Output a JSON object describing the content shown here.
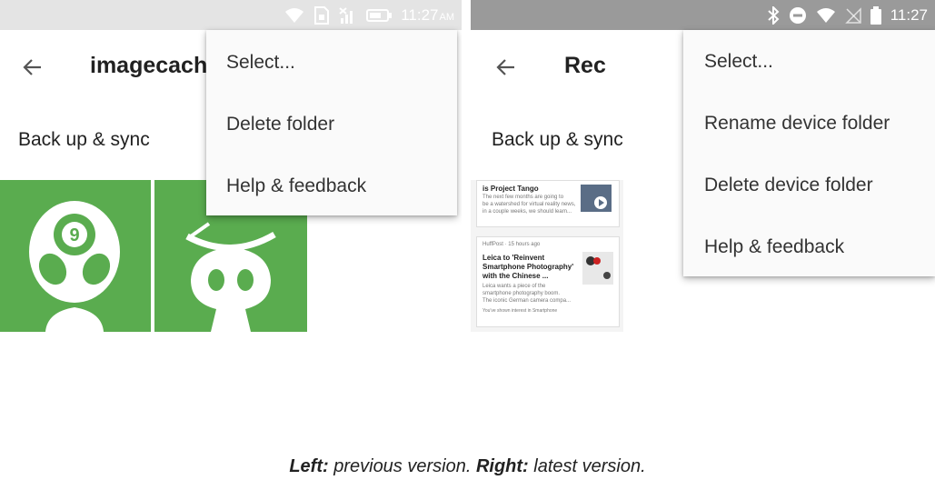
{
  "left_screen": {
    "status": {
      "time": "11:27",
      "ampm": "AM",
      "icons": [
        "wifi-icon",
        "sim-card-icon",
        "no-signal-icon",
        "battery-icon"
      ]
    },
    "toolbar": {
      "title": "imagecache",
      "back_icon": "back-arrow-icon"
    },
    "section_label": "Back up & sync",
    "menu": {
      "items": [
        "Select...",
        "Delete folder",
        "Help & feedback"
      ]
    },
    "tiles": [
      "alien-sticker-image",
      "hat-sticker-image"
    ],
    "colors": {
      "status_bar": "#e4e4e4",
      "tile_green": "#5aac4f",
      "menu_bg": "#fafafa"
    }
  },
  "right_screen": {
    "status": {
      "time": "11:27",
      "icons": [
        "bluetooth-icon",
        "do-not-disturb-icon",
        "wifi-icon",
        "no-sim-icon",
        "battery-icon"
      ]
    },
    "toolbar": {
      "title": "Rec",
      "back_icon": "back-arrow-icon"
    },
    "section_label": "Back up & sync",
    "menu": {
      "items": [
        "Select...",
        "Rename device folder",
        "Delete device folder",
        "Help & feedback"
      ]
    },
    "thumbnail": {
      "card1": {
        "title": "is Project Tango",
        "lines": [
          "The next few months are going to",
          "be a watershed for virtual reality news,",
          "in a couple weeks, we should learn..."
        ]
      },
      "card2": {
        "source": "HuffPost · 15 hours ago",
        "title": [
          "Leica to 'Reinvent",
          "Smartphone Photography'",
          "with the Chinese ..."
        ],
        "lines": [
          "Leica wants a piece of the",
          "smartphone photography boom.",
          "The iconic German camera compa..."
        ],
        "footer": "You've shown interest in Smartphone"
      }
    },
    "colors": {
      "status_bar": "#9a9a9a",
      "menu_bg": "#fafafa"
    }
  },
  "caption": {
    "left_label": "Left:",
    "left_text": " previous version. ",
    "right_label": "Right:",
    "right_text": " latest version."
  }
}
